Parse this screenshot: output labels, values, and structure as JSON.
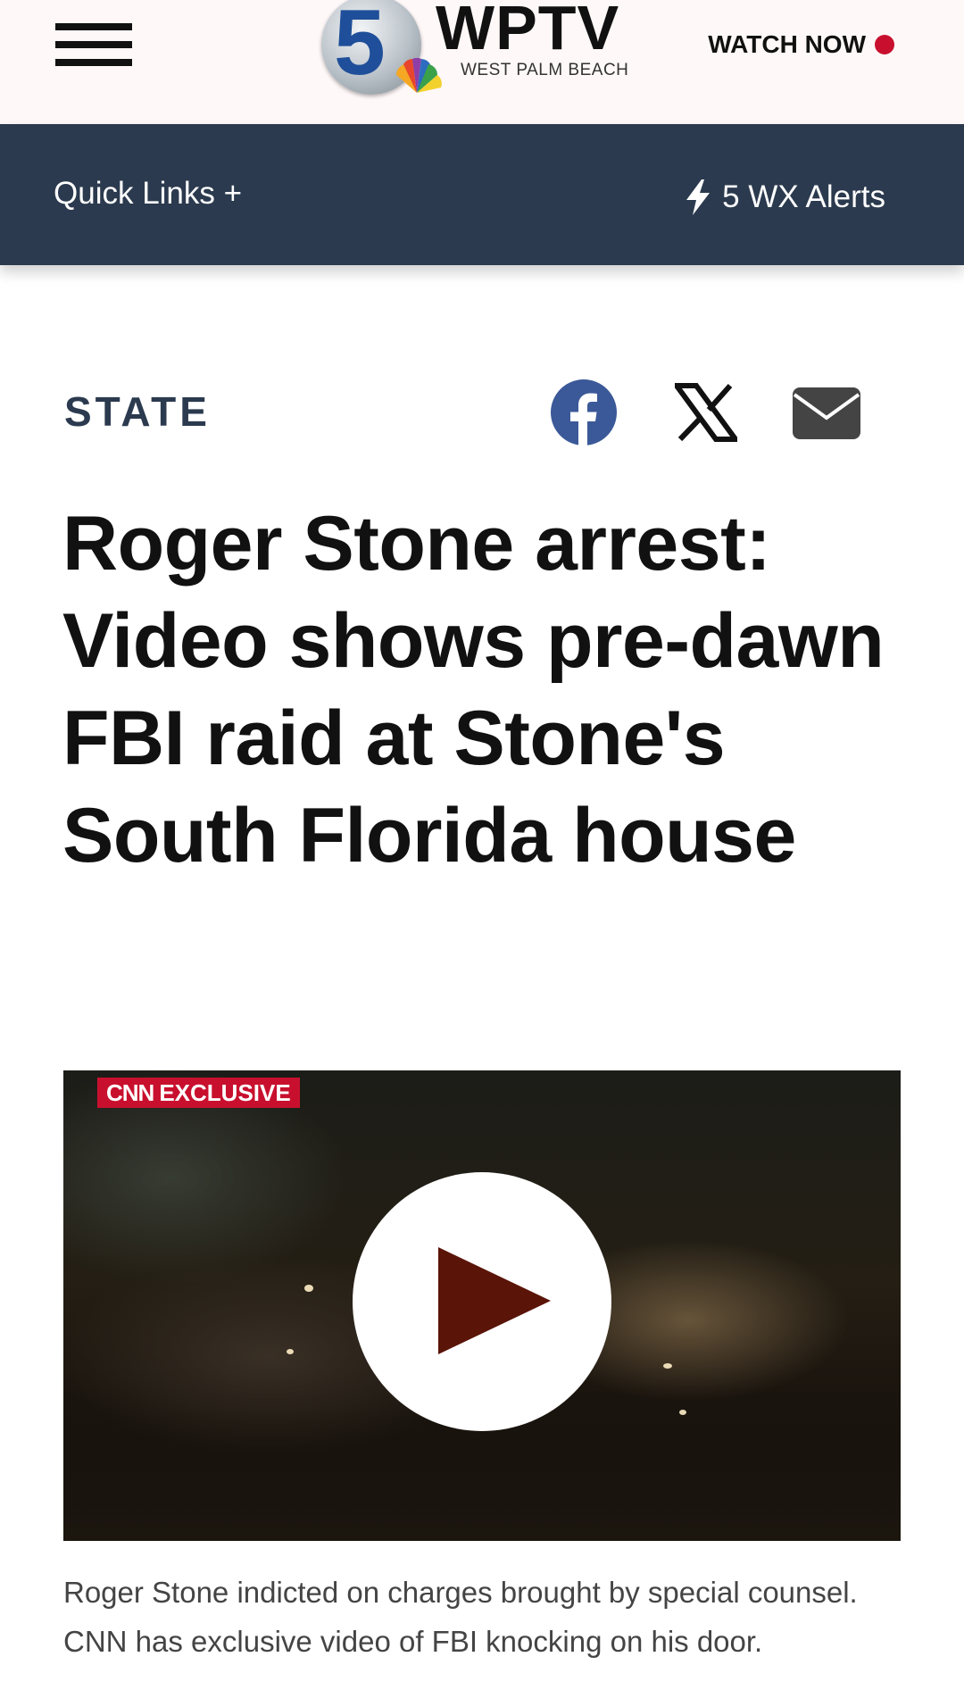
{
  "header": {
    "menu_icon": "hamburger-menu-icon",
    "logo": {
      "channel_number": "5",
      "name": "WPTV",
      "subtitle": "WEST PALM BEACH"
    },
    "watch_now": {
      "label": "WATCH NOW",
      "indicator_color": "#c8102e"
    }
  },
  "navbar": {
    "background": "#2b3a4e",
    "quick_links_label": "Quick Links +",
    "wx_alerts": {
      "icon": "lightning-bolt-icon",
      "label": "5 WX Alerts"
    }
  },
  "article": {
    "section": "STATE",
    "share": [
      {
        "icon": "facebook-icon",
        "color": "#3b5998"
      },
      {
        "icon": "x-twitter-icon",
        "color": "#111111"
      },
      {
        "icon": "email-icon",
        "color": "#444444"
      }
    ],
    "headline": "Roger Stone arrest: Video shows pre-dawn FBI raid at Stone's South Florida house",
    "video": {
      "badge_network": "CNN",
      "badge_text": "EXCLUSIVE",
      "badge_color": "#c8102e",
      "play_icon": "play-icon",
      "play_icon_color": "#5a1408"
    },
    "caption": "Roger Stone indicted on charges brought by special counsel. CNN has exclusive video of FBI knocking on his door."
  }
}
